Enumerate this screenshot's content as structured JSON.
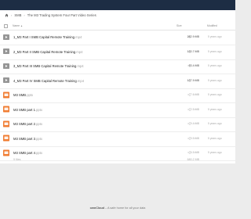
{
  "breadcrumb": {
    "home_icon": "home-icon",
    "items": [
      "SMB",
      "The M3 Trading System Four Part Video Series"
    ]
  },
  "table": {
    "headers": {
      "name": "Name",
      "name_sort_arrow": "▲",
      "size": "Size",
      "modified": "Modified"
    },
    "rows": [
      {
        "icon": "video-icon",
        "name": "1_M3 Part I SMB Capital Remote Training",
        "ext": ".mp4",
        "size": "282.9 MB",
        "modified": "5 years ago"
      },
      {
        "icon": "video-icon",
        "name": "2_M3 Part II SMB Capital Remote Training",
        "ext": ".mp4",
        "size": "130.7 MB",
        "modified": "5 years ago"
      },
      {
        "icon": "video-icon",
        "name": "3_M3 Part III SMB Capital Remote Training",
        "ext": ".mp4",
        "size": "93.4 MB",
        "modified": "5 years ago"
      },
      {
        "icon": "video-icon",
        "name": "4_M3 Part IV SMB Capital Remote Training",
        "ext": ".mp4",
        "size": "137.9 MB",
        "modified": "5 years ago"
      },
      {
        "icon": "presentation-icon",
        "name": "M3 SMB",
        "ext": ".pptx",
        "size": "7.6 MB",
        "modified": "5 years ago"
      },
      {
        "icon": "presentation-icon",
        "name": "M3 SMB part 1",
        "ext": ".pptx",
        "size": "2.5 MB",
        "modified": "5 years ago"
      },
      {
        "icon": "presentation-icon",
        "name": "M3 SMB part 2",
        "ext": ".pptx",
        "size": "9.4 MB",
        "modified": "5 years ago"
      },
      {
        "icon": "presentation-icon",
        "name": "M3 SMB part 3",
        "ext": ".pptx",
        "size": "9.5 MB",
        "modified": "5 years ago"
      },
      {
        "icon": "presentation-icon",
        "name": "M3 SMB part 4",
        "ext": ".pptx",
        "size": "6.5 MB",
        "modified": "5 years ago"
      }
    ],
    "summary": {
      "files": "9 files",
      "total": "680.2 MB"
    }
  },
  "footer": {
    "brand": "ownCloud",
    "tagline": " – A safe home for all your data"
  },
  "colors": {
    "topbar": "#1d2d44",
    "video_icon": "#969696",
    "presentation_icon": "#f07d33"
  }
}
